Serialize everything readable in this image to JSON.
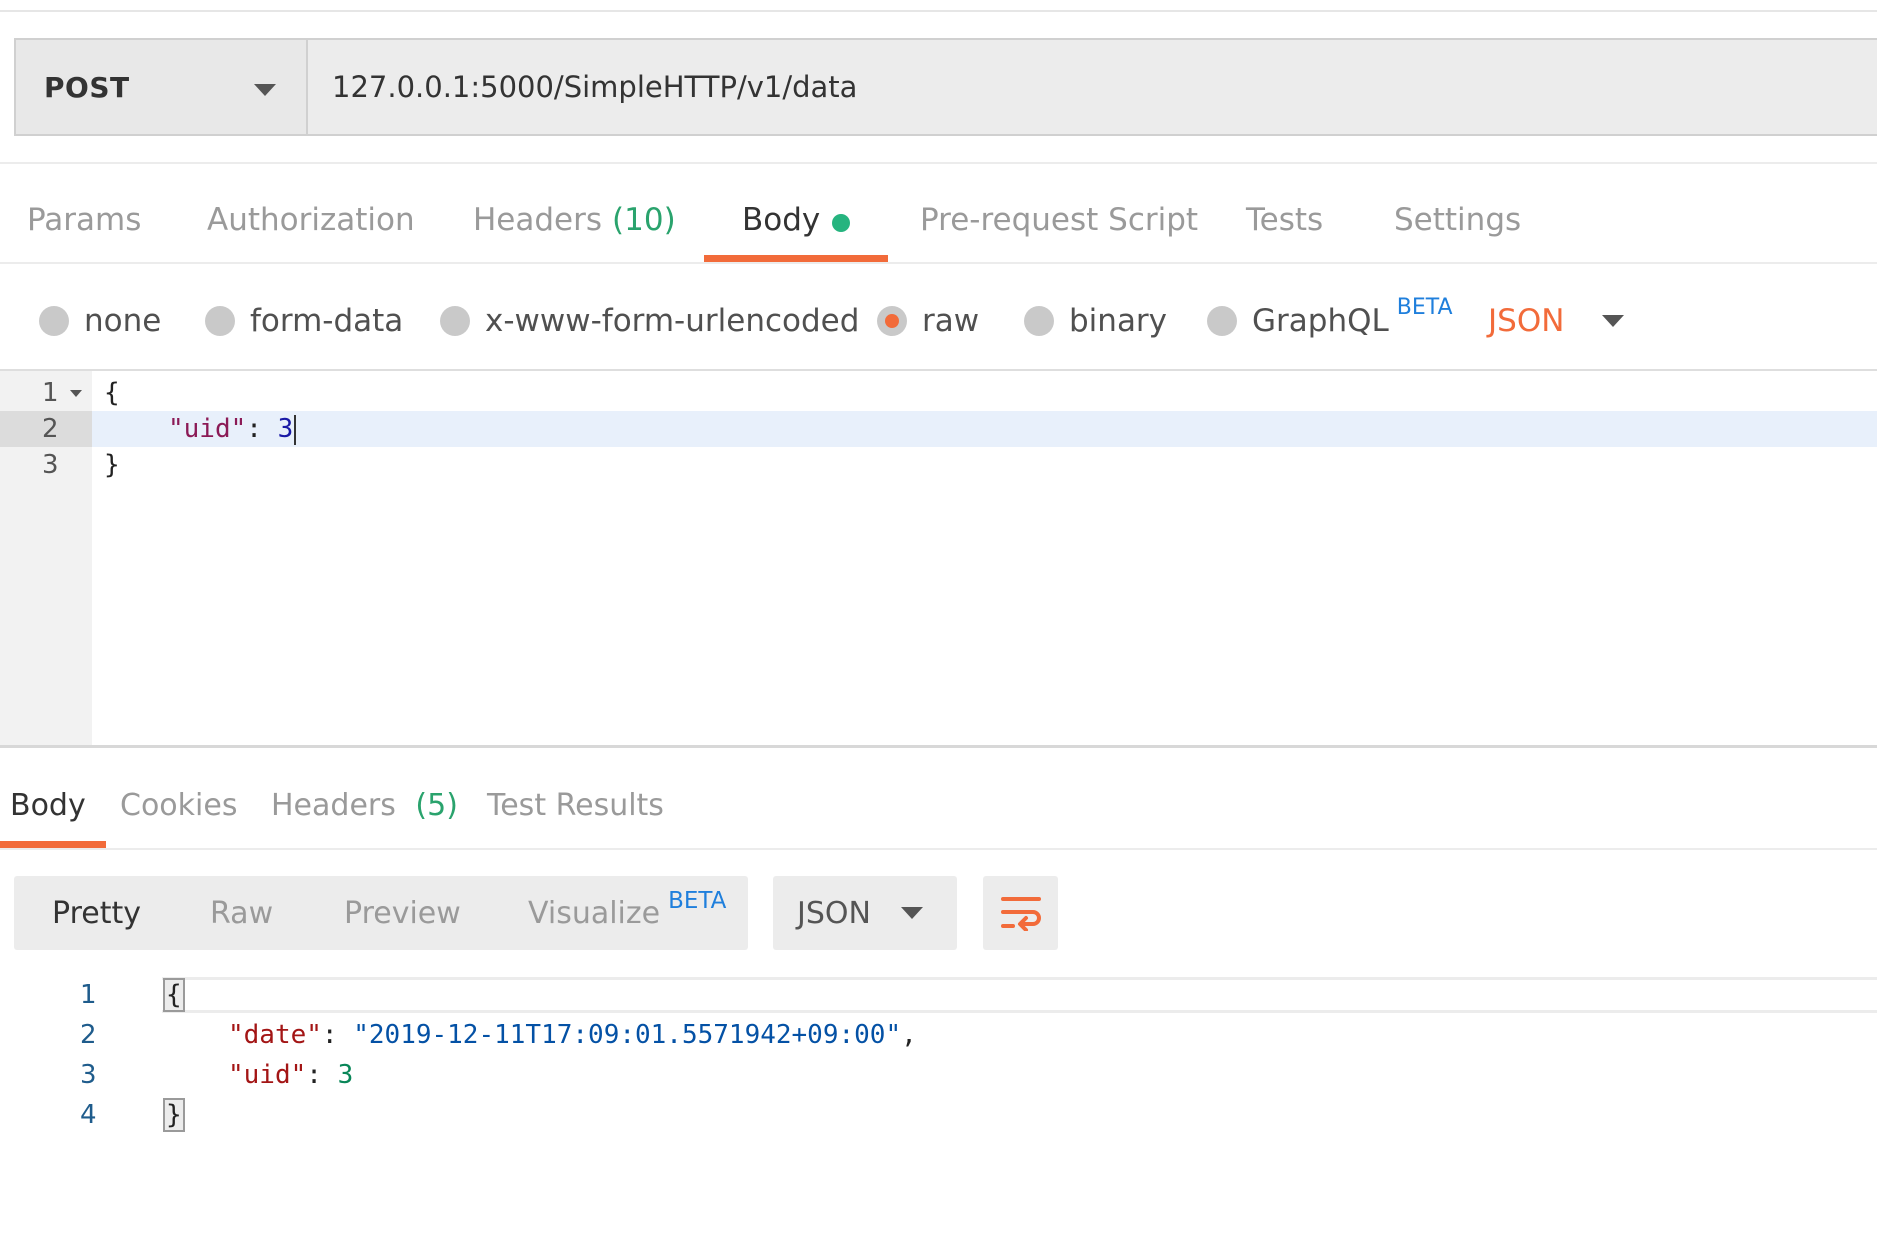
{
  "request": {
    "method": "POST",
    "url": "127.0.0.1:5000/SimpleHTTP/v1/data"
  },
  "request_tabs": [
    {
      "label": "Params"
    },
    {
      "label": "Authorization"
    },
    {
      "label": "Headers",
      "count": "(10)"
    },
    {
      "label": "Body",
      "active": true,
      "indicator": "green-dot"
    },
    {
      "label": "Pre-request Script"
    },
    {
      "label": "Tests"
    },
    {
      "label": "Settings"
    }
  ],
  "body_types": [
    {
      "label": "none",
      "checked": false
    },
    {
      "label": "form-data",
      "checked": false
    },
    {
      "label": "x-www-form-urlencoded",
      "checked": false
    },
    {
      "label": "raw",
      "checked": true
    },
    {
      "label": "binary",
      "checked": false
    },
    {
      "label": "GraphQL",
      "badge": "BETA",
      "checked": false
    }
  ],
  "body_format": "JSON",
  "request_editor": {
    "lines": [
      {
        "number": "1",
        "text": "{"
      },
      {
        "number": "2",
        "key": "\"uid\"",
        "sep": ": ",
        "value": "3"
      },
      {
        "number": "3",
        "text": "}"
      }
    ]
  },
  "response_tabs": [
    {
      "label": "Body",
      "active": true
    },
    {
      "label": "Cookies"
    },
    {
      "label": "Headers",
      "count": "(5)"
    },
    {
      "label": "Test Results"
    }
  ],
  "response_view": {
    "modes": [
      {
        "label": "Pretty",
        "active": true
      },
      {
        "label": "Raw"
      },
      {
        "label": "Preview"
      },
      {
        "label": "Visualize",
        "badge": "BETA"
      }
    ],
    "format": "JSON",
    "wrap_icon": "wrap-lines-icon"
  },
  "response_body": {
    "lines": [
      {
        "number": "1",
        "text": "{"
      },
      {
        "number": "2",
        "key": "\"date\"",
        "sep": ": ",
        "value": "\"2019-12-11T17:09:01.5571942+09:00\"",
        "trail": ","
      },
      {
        "number": "3",
        "key": "\"uid\"",
        "sep": ": ",
        "value": "3"
      },
      {
        "number": "4",
        "text": "}"
      }
    ]
  },
  "colors": {
    "accent": "#f26b3a",
    "count_green": "#2aa36d",
    "beta_blue": "#1f7fdc"
  }
}
